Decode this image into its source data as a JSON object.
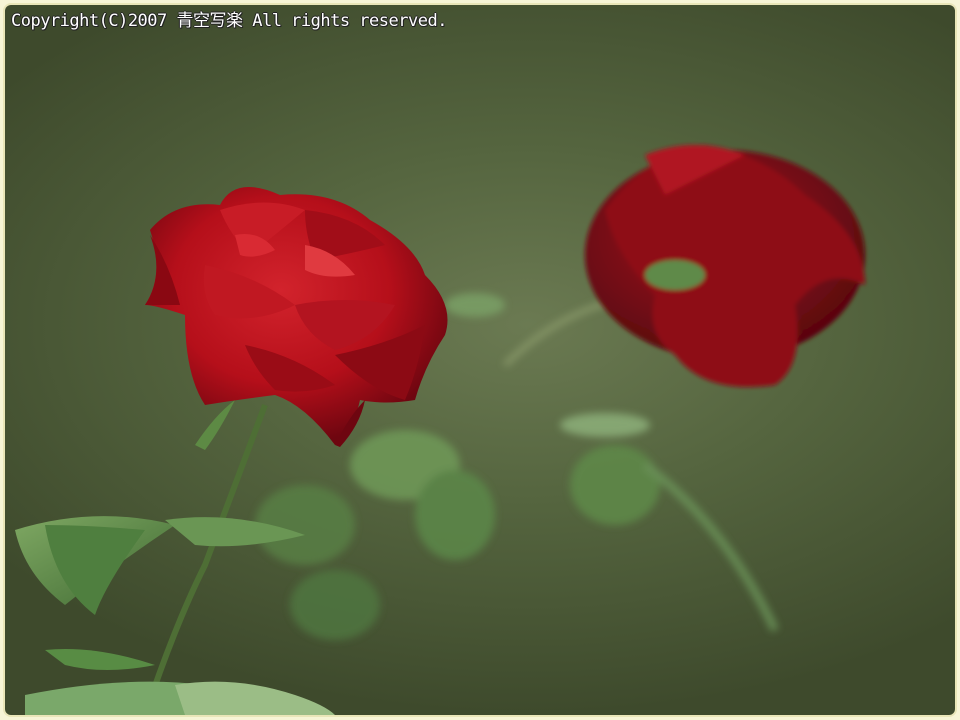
{
  "photo": {
    "copyright": "Copyright(C)2007 青空写楽 All rights reserved.",
    "colors": {
      "background": "#55653f",
      "rose": "#b0101a",
      "leaf": "#5f8a4a",
      "frame": "#f7f5d6"
    }
  }
}
